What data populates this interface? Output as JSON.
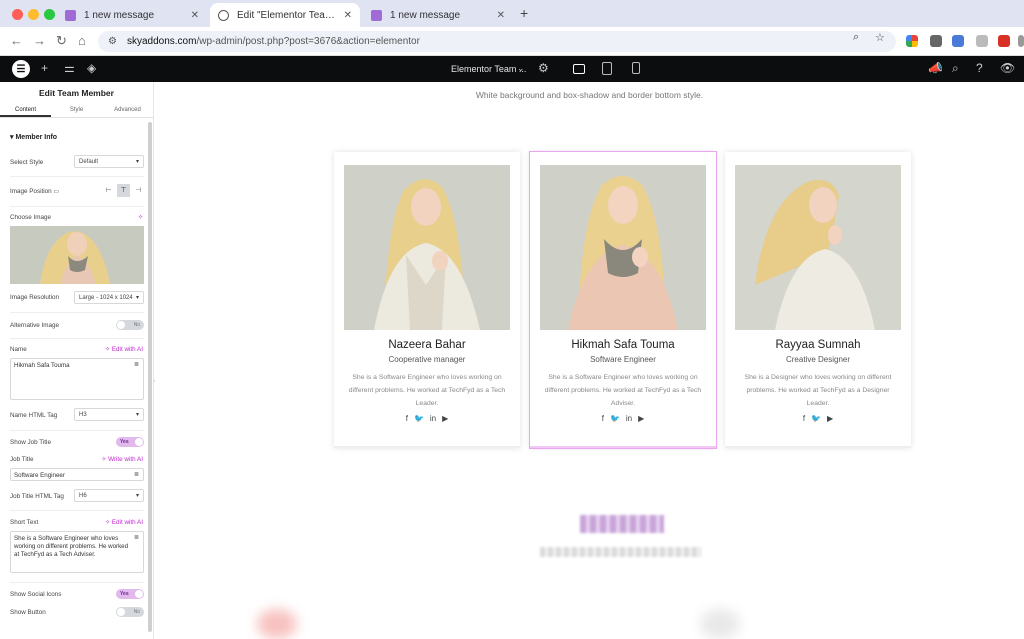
{
  "browser": {
    "tabs": [
      {
        "title": "1 new message",
        "favicon": "chat-icon",
        "active": false
      },
      {
        "title": "Edit \"Elementor Team Member\"",
        "favicon": "globe-icon",
        "active": true
      },
      {
        "title": "1 new message",
        "favicon": "chat-icon",
        "active": false
      }
    ],
    "url_host": "skyaddons.com",
    "url_path": "/wp-admin/post.php?post=3676&action=elementor"
  },
  "topbar": {
    "document_title": "Elementor Team ...",
    "accent": "#0c0d0e"
  },
  "panel": {
    "title": "Edit Team Member",
    "tabs": [
      "Content",
      "Style",
      "Advanced"
    ],
    "section": "Member Info",
    "select_style_label": "Select Style",
    "select_style_value": "Default",
    "image_position_label": "Image Position",
    "choose_image_label": "Choose Image",
    "image_resolution_label": "Image Resolution",
    "image_resolution_value": "Large - 1024 x 1024",
    "alt_image_label": "Alternative Image",
    "alt_image_toggle": "No",
    "name_label": "Name",
    "name_ai": "Edit with AI",
    "name_value": "Hikmah Safa Touma",
    "name_tag_label": "Name HTML Tag",
    "name_tag_value": "H3",
    "show_job_label": "Show Job Title",
    "show_job_toggle": "Yes",
    "job_title_label": "Job Title",
    "job_title_ai": "Write with AI",
    "job_title_value": "Software Engineer",
    "job_tag_label": "Job Title HTML Tag",
    "job_tag_value": "H6",
    "short_text_label": "Short Text",
    "short_text_ai": "Edit with AI",
    "short_text_value": "She is a Software Engineer who loves working on different problems. He worked at TechFyd as a Tech Adviser.",
    "show_social_label": "Show Social Icons",
    "show_social_toggle": "Yes",
    "show_button_label": "Show Button",
    "show_button_toggle": "No",
    "accent": "#c026d3"
  },
  "preview": {
    "section_subtitle": "White background and box-shadow and border bottom style.",
    "cards": [
      {
        "name": "Nazeera Bahar",
        "job": "Cooperative manager",
        "text": "She is a Software Engineer who loves working on different problems. He worked at TechFyd as a Tech Leader.",
        "selected": false
      },
      {
        "name": "Hikmah Safa Touma",
        "job": "Software Engineer",
        "text": "She is a Software Engineer who loves working on different problems. He worked at TechFyd as a Tech Adviser.",
        "selected": true
      },
      {
        "name": "Rayyaa Sumnah",
        "job": "Creative Designer",
        "text": "She is a Designer who loves working on different problems. He worked at TechFyd as a Designer Leader.",
        "selected": false
      }
    ]
  }
}
